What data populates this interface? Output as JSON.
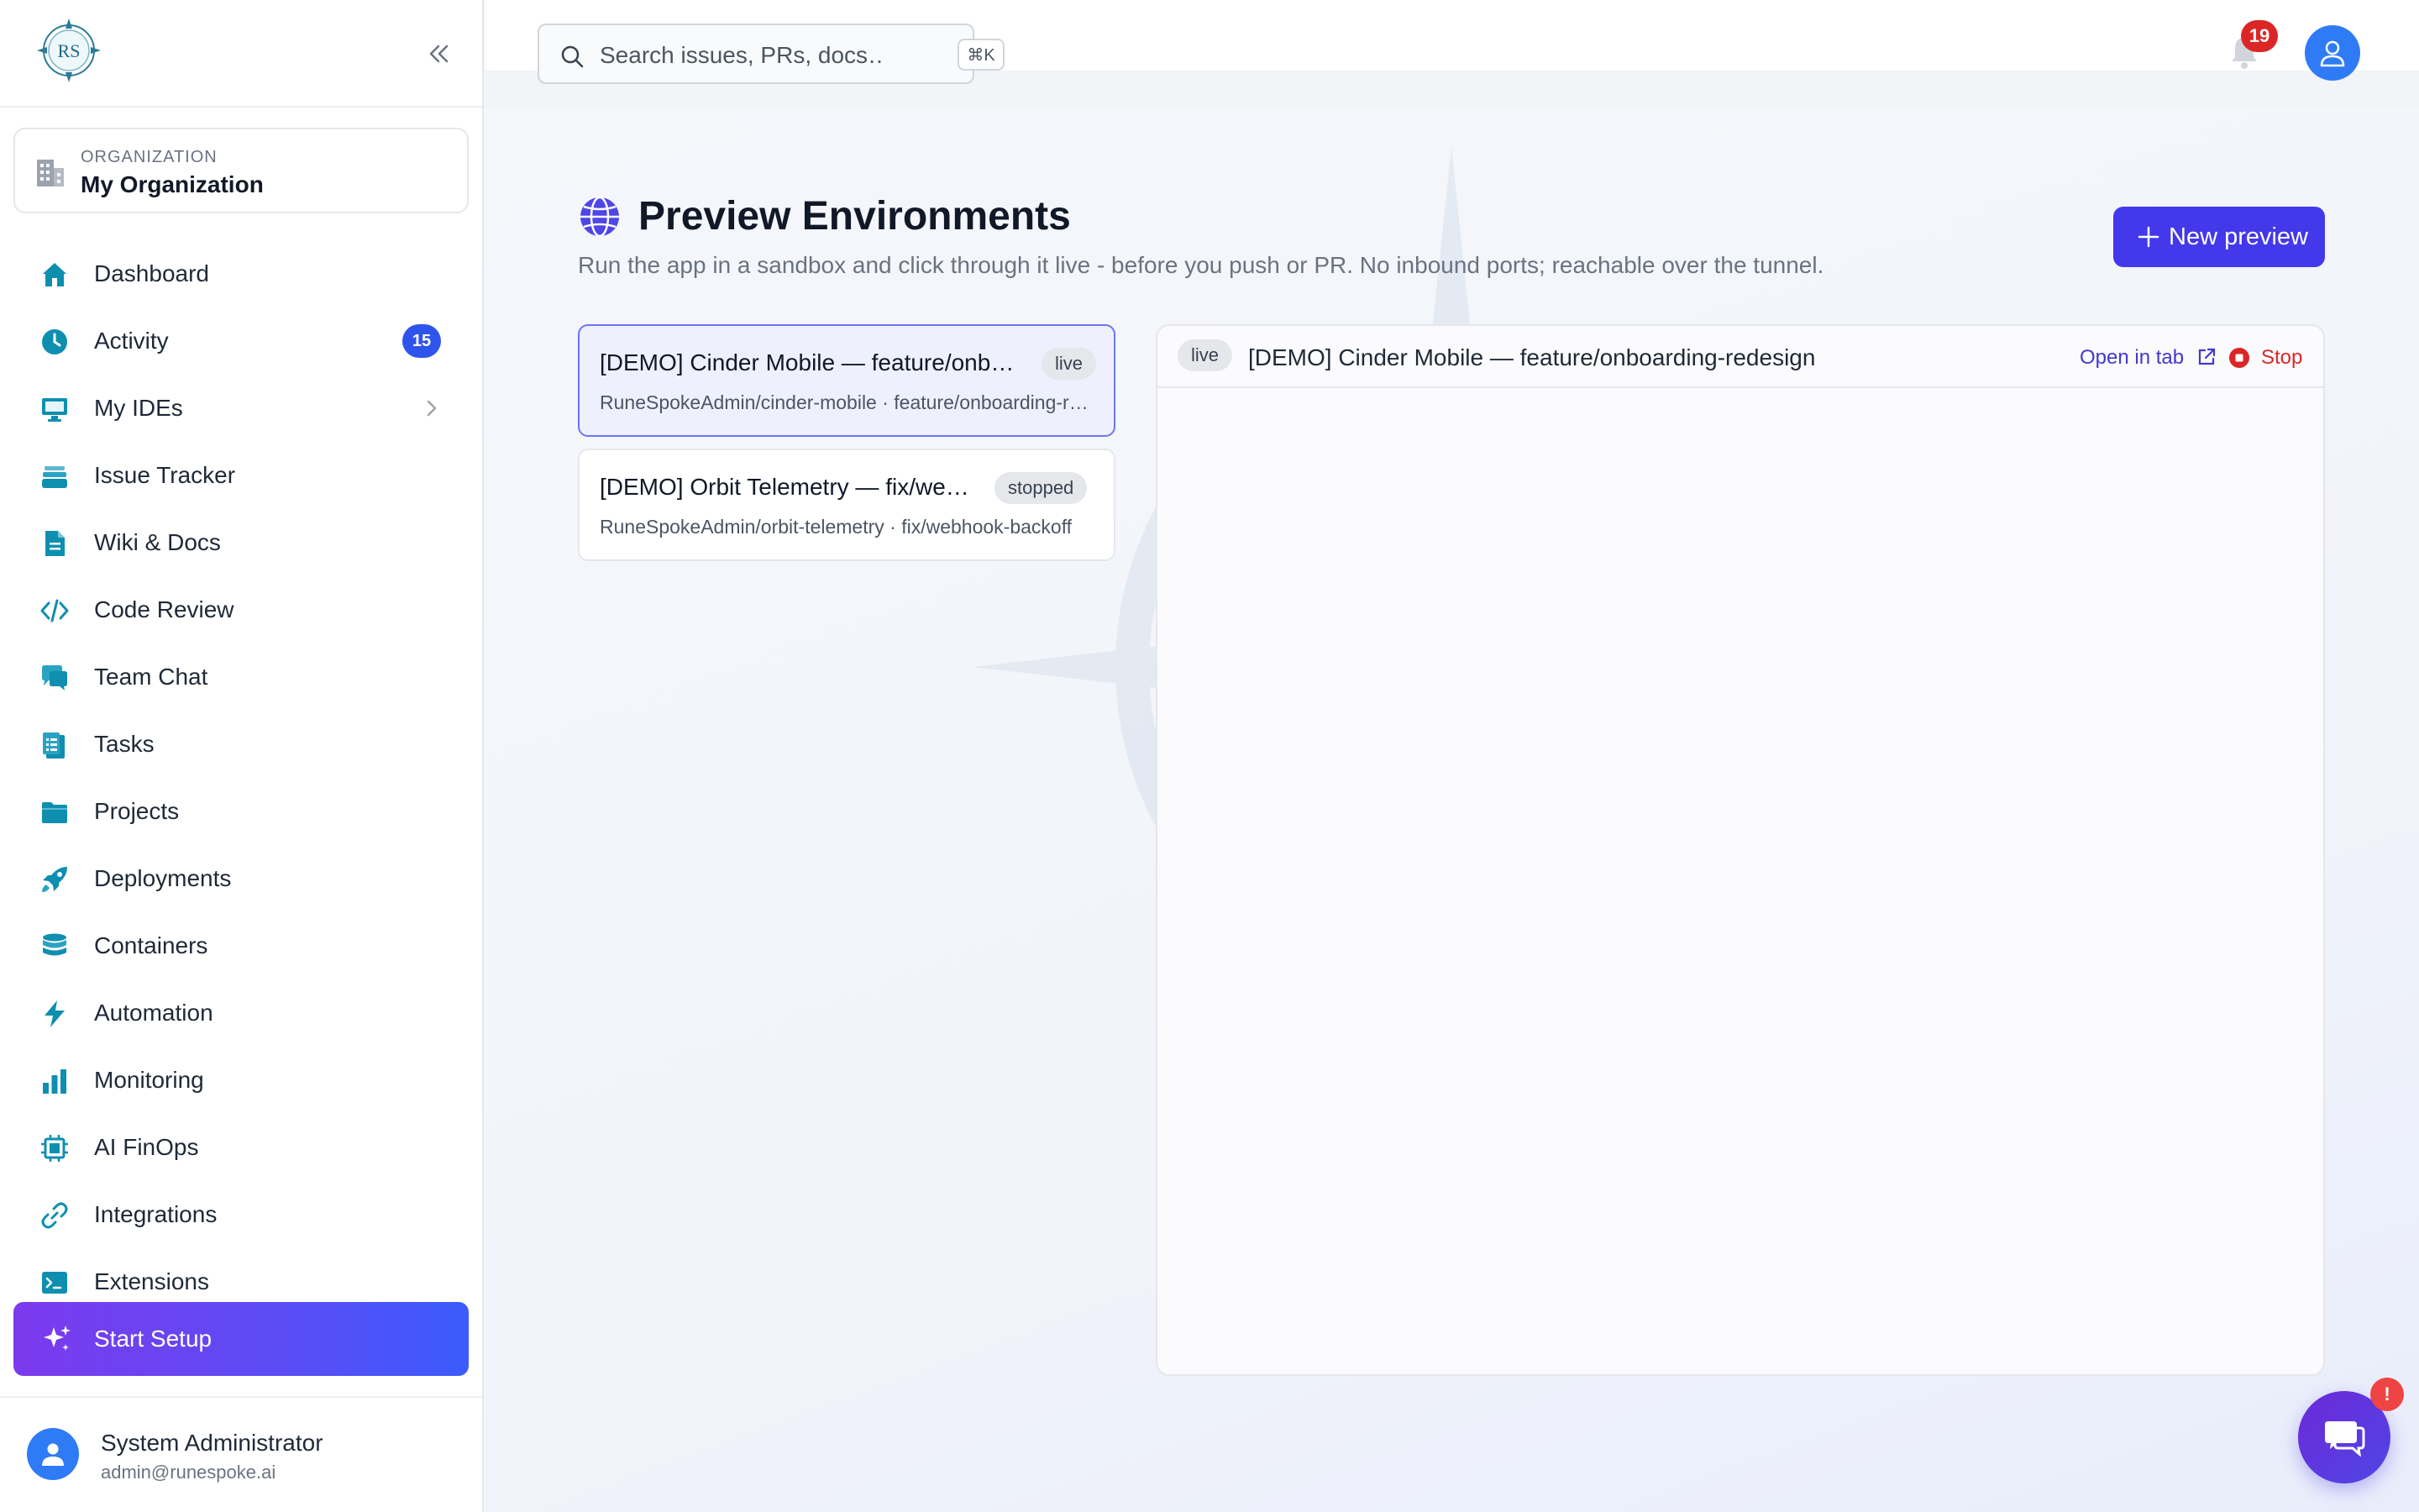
{
  "app": {
    "brand_initials": "RS"
  },
  "sidebar": {
    "organization": {
      "label": "ORGANIZATION",
      "name": "My Organization"
    },
    "items": [
      {
        "id": "dashboard",
        "label": "Dashboard",
        "icon": "home-icon"
      },
      {
        "id": "activity",
        "label": "Activity",
        "icon": "clock-icon",
        "badge": "15"
      },
      {
        "id": "my-ides",
        "label": "My IDEs",
        "icon": "monitor-icon"
      },
      {
        "id": "issue-tracker",
        "label": "Issue Tracker",
        "icon": "stack-icon"
      },
      {
        "id": "wiki-docs",
        "label": "Wiki & Docs",
        "icon": "document-icon"
      },
      {
        "id": "code-review",
        "label": "Code Review",
        "icon": "code-icon"
      },
      {
        "id": "team-chat",
        "label": "Team Chat",
        "icon": "chat-icon"
      },
      {
        "id": "tasks",
        "label": "Tasks",
        "icon": "clipboard-icon"
      },
      {
        "id": "projects",
        "label": "Projects",
        "icon": "folder-icon"
      },
      {
        "id": "deployments",
        "label": "Deployments",
        "icon": "rocket-icon"
      },
      {
        "id": "containers",
        "label": "Containers",
        "icon": "database-icon"
      },
      {
        "id": "automation",
        "label": "Automation",
        "icon": "bolt-icon"
      },
      {
        "id": "monitoring",
        "label": "Monitoring",
        "icon": "bar-chart-icon"
      },
      {
        "id": "ai-finops",
        "label": "AI FinOps",
        "icon": "chip-icon"
      },
      {
        "id": "integrations",
        "label": "Integrations",
        "icon": "link-icon"
      },
      {
        "id": "extensions",
        "label": "Extensions",
        "icon": "terminal-icon"
      }
    ],
    "setup_label": "Start Setup",
    "user": {
      "name": "System Administrator",
      "email": "admin@runespoke.ai"
    }
  },
  "topbar": {
    "search_placeholder": "Search issues, PRs, docs…",
    "search_shortcut": "⌘K",
    "notification_count": "19"
  },
  "main": {
    "title": "Preview Environments",
    "subtitle": "Run the app in a sandbox and click through it live - before you push or PR. No inbound ports; reachable over the tunnel.",
    "new_button_label": "New preview",
    "environments": [
      {
        "title": "[DEMO] Cinder Mobile — feature/onboarding-redesign",
        "status": "live",
        "meta": "RuneSpokeAdmin/cinder-mobile · feature/onboarding-redesign",
        "active": true
      },
      {
        "title": "[DEMO] Orbit Telemetry — fix/webhook-backoff",
        "status": "stopped",
        "meta": "RuneSpokeAdmin/orbit-telemetry · fix/webhook-backoff",
        "active": false
      }
    ],
    "preview": {
      "status": "live",
      "title": "[DEMO] Cinder Mobile — feature/onboarding-redesign",
      "open_in_tab_label": "Open in tab",
      "stop_label": "Stop"
    }
  },
  "chat": {
    "badge": "!"
  },
  "colors": {
    "accent": "#4338ea",
    "sidebar_icon": "#0e8fb0",
    "danger": "#dc2626"
  }
}
